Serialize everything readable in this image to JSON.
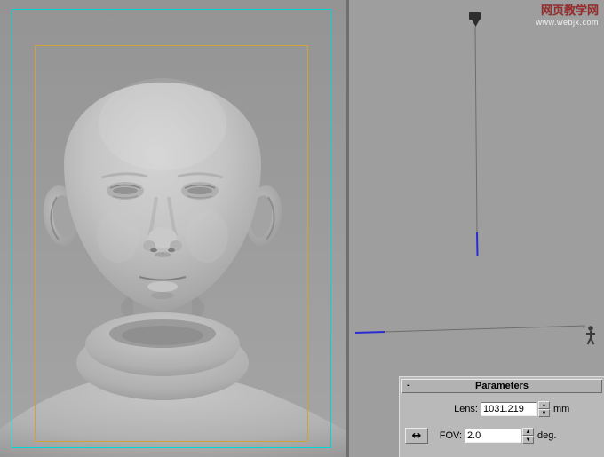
{
  "watermark": {
    "line1": "网页教学网",
    "line2": "www.webjx.com"
  },
  "panel": {
    "title": "Parameters",
    "collapse": "-",
    "lens": {
      "label": "Lens:",
      "value": "1031.219",
      "unit": "mm"
    },
    "fov": {
      "label": "FOV:",
      "value": "2.0",
      "unit": "deg."
    }
  },
  "icons": {
    "spinner_up": "▲",
    "spinner_down": "▼",
    "fov_direction": "↔"
  },
  "colors": {
    "viewport_bg": "#9e9e9e",
    "safe_frame_outer": "#00d8d8",
    "safe_frame_inner": "#cfa23a",
    "selection_blue": "#2b2bd4",
    "panel_bg": "#b9b9b9"
  }
}
